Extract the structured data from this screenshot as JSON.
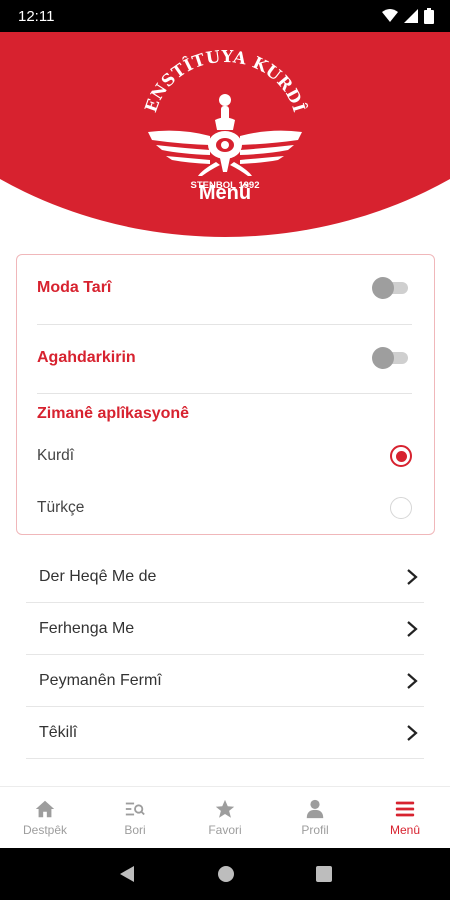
{
  "status_bar": {
    "time": "12:11"
  },
  "header": {
    "logo_name": "ENSTÎTUYA KURDÎ",
    "logo_subtitle": "STENBOL 1992",
    "title": "Menû"
  },
  "settings": {
    "dark_mode": {
      "label": "Moda Tarî",
      "enabled": false
    },
    "notifications": {
      "label": "Agahdarkirin",
      "enabled": false
    },
    "language": {
      "title": "Zimanê aplîkasyonê",
      "options": [
        {
          "label": "Kurdî",
          "selected": true
        },
        {
          "label": "Türkçe",
          "selected": false
        }
      ]
    }
  },
  "menu_items": [
    {
      "label": "Der Heqê Me de"
    },
    {
      "label": "Ferhenga Me"
    },
    {
      "label": "Peymanên Fermî"
    },
    {
      "label": "Têkilî"
    }
  ],
  "bottom_nav": [
    {
      "label": "Destpêk",
      "icon": "home-icon",
      "active": false
    },
    {
      "label": "Bori",
      "icon": "search-list-icon",
      "active": false
    },
    {
      "label": "Favori",
      "icon": "star-icon",
      "active": false
    },
    {
      "label": "Profil",
      "icon": "person-icon",
      "active": false
    },
    {
      "label": "Menû",
      "icon": "menu-icon",
      "active": true
    }
  ],
  "colors": {
    "accent": "#d7222f",
    "toggle_off": "#9e9e9e",
    "inactive": "#9d9d9d"
  }
}
